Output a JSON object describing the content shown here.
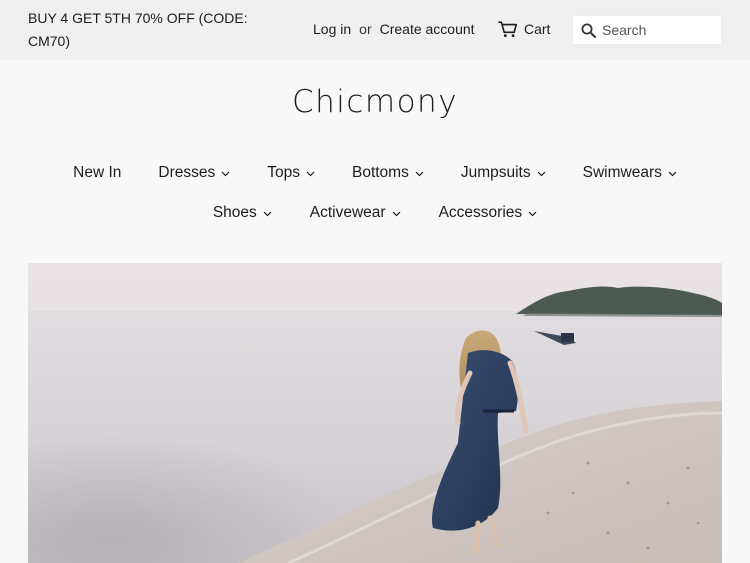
{
  "announcement": {
    "text": "BUY 4 GET 5TH 70% OFF (CODE: CM70)"
  },
  "account": {
    "login_label": "Log in",
    "or_label": "or",
    "create_label": "Create account"
  },
  "cart": {
    "label": "Cart",
    "icon": "cart-icon"
  },
  "search": {
    "placeholder": "Search",
    "icon": "search-icon"
  },
  "logo": {
    "text": "Chicmony"
  },
  "nav": {
    "row1": [
      {
        "label": "New In",
        "has_dropdown": false
      },
      {
        "label": "Dresses",
        "has_dropdown": true
      },
      {
        "label": "Tops",
        "has_dropdown": true
      },
      {
        "label": "Bottoms",
        "has_dropdown": true
      },
      {
        "label": "Jumpsuits",
        "has_dropdown": true
      },
      {
        "label": "Swimwears",
        "has_dropdown": true
      }
    ],
    "row2": [
      {
        "label": "Shoes",
        "has_dropdown": true
      },
      {
        "label": "Activewear",
        "has_dropdown": true
      },
      {
        "label": "Accessories",
        "has_dropdown": true
      }
    ]
  },
  "colors": {
    "topbar_bg": "#f0f0f0",
    "page_bg": "#f8f8f8",
    "text": "#1c1c1c"
  }
}
